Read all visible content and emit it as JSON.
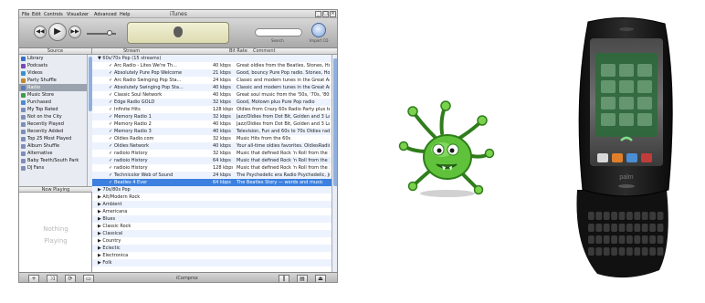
{
  "itunes": {
    "window_title": "iTunes",
    "menu": [
      "File",
      "Edit",
      "Controls",
      "Visualizer",
      "Advanced",
      "Help"
    ],
    "search_label": "Search",
    "cd_label": "Import CD",
    "source_header": "Source",
    "sources": [
      {
        "label": "Library",
        "color": "#3b6fc2"
      },
      {
        "label": "Podcasts",
        "color": "#7a4ab4"
      },
      {
        "label": "Videos",
        "color": "#3b8fd0"
      },
      {
        "label": "Party Shuffle",
        "color": "#c08a2a"
      },
      {
        "label": "Radio",
        "color": "#5a7db8",
        "selected": true
      },
      {
        "label": "Music Store",
        "color": "#3f9b4a"
      },
      {
        "label": "Purchased",
        "color": "#4a8ccf"
      },
      {
        "label": "My Top Rated",
        "color": "#7d8fb8"
      },
      {
        "label": "Not on the City",
        "color": "#7d8fb8"
      },
      {
        "label": "Recently Played",
        "color": "#7d8fb8"
      },
      {
        "label": "Recently Added",
        "color": "#7d8fb8"
      },
      {
        "label": "Top 25 Most Played",
        "color": "#7d8fb8"
      },
      {
        "label": "Album Shuffle",
        "color": "#7d8fb8"
      },
      {
        "label": "Alternative",
        "color": "#7d8fb8"
      },
      {
        "label": "Baby Teeth/South Park",
        "color": "#7d8fb8"
      },
      {
        "label": "DJ Fans",
        "color": "#7d8fb8"
      }
    ],
    "now_playing_header": "Now Playing",
    "now_playing_text": [
      "Nothing",
      "Playing"
    ],
    "columns": {
      "stream": "Stream",
      "bitrate": "Bit Rate",
      "comment": "Comment"
    },
    "songs": [
      {
        "group": true,
        "name": "▼ 60s/70s Pop (15 streams)"
      },
      {
        "name": "Arc Radio - Lites We're Th...",
        "rate": "40 kbps",
        "comment": "Great oldies from the Beatles, Stones, Hollies"
      },
      {
        "name": "Absolutely Pure Pop Welcome",
        "rate": "21 kbps",
        "comment": "Good, bouncy Pure Pop radio. Stones, Hollies"
      },
      {
        "name": "Arc Radio Swinging Pop Sta...",
        "rate": "24 kbps",
        "comment": "Classic and modern tunes in the Great American..."
      },
      {
        "name": "Absolutely Swinging Pop Sta...",
        "rate": "40 kbps",
        "comment": "Classic and modern tunes in the Great American"
      },
      {
        "name": "Classic Soul Network",
        "rate": "40 kbps",
        "comment": "Great soul music from the '50s, '70s, '80s, and '90s"
      },
      {
        "name": "Edge Radio GOLD",
        "rate": "32 kbps",
        "comment": "Good, Motown plus Pure Pop radio"
      },
      {
        "name": "Infinite Hits",
        "rate": "128 kbps",
        "comment": "Oldies from Crazy 60s Radio Party plus tech"
      },
      {
        "name": "Memory Radio 1",
        "rate": "32 kbps",
        "comment": "Jazz/Oldies from Dot Bit, Golden and 3 Lane"
      },
      {
        "name": "Memory Radio 2",
        "rate": "40 kbps",
        "comment": "Jazz/Oldies from Dot Bit, Golden and 3 Lane"
      },
      {
        "name": "Memory Radio 3",
        "rate": "40 kbps",
        "comment": "Television, Fun and 60s to 70s Oldies radio"
      },
      {
        "name": "Oldies Radio.com",
        "rate": "32 kbps",
        "comment": "Music Hits from the 60s"
      },
      {
        "name": "Oldies Network",
        "rate": "40 kbps",
        "comment": "Your all-time oldies favorites. OldiesRadio"
      },
      {
        "name": "radioio History",
        "rate": "32 kbps",
        "comment": "Music that defined Rock 'n Roll from the 50s to"
      },
      {
        "name": "radioio History",
        "rate": "64 kbps",
        "comment": "Music that defined Rock 'n Roll from the 50s to"
      },
      {
        "name": "radioio History",
        "rate": "128 kbps",
        "comment": "Music that defined Rock 'n Roll from the 50s"
      },
      {
        "name": "Technicolor Web of Sound",
        "rate": "24 kbps",
        "comment": "The Psychedelic era Radio Psychedelic, jumping"
      },
      {
        "name": "Beatles 4 Ever",
        "rate": "64 kbps",
        "comment": "The Beatles Story — words and music",
        "selected": true
      },
      {
        "group": true,
        "name": "▶ 70s/80s Pop"
      },
      {
        "group": true,
        "name": "▶ Alt/Modern Rock"
      },
      {
        "group": true,
        "name": "▶ Ambient"
      },
      {
        "group": true,
        "name": "▶ Americana"
      },
      {
        "group": true,
        "name": "▶ Blues"
      },
      {
        "group": true,
        "name": "▶ Classic Rock"
      },
      {
        "group": true,
        "name": "▶ Classical"
      },
      {
        "group": true,
        "name": "▶ Country"
      },
      {
        "group": true,
        "name": "▶ Eclectic"
      },
      {
        "group": true,
        "name": "▶ Electronica"
      },
      {
        "group": true,
        "name": "▶ Folk"
      }
    ],
    "status_brand": "iComprox",
    "status_buttons": [
      "+",
      "⤨",
      "⟳",
      "▭"
    ],
    "view_buttons": [
      "‖",
      "▤",
      "⏏"
    ]
  },
  "colors": {
    "selection": "#3d80df",
    "source_selection": "#9aa3ad",
    "bug_green": "#5fc23a"
  },
  "phone": {
    "brand": "palm"
  }
}
